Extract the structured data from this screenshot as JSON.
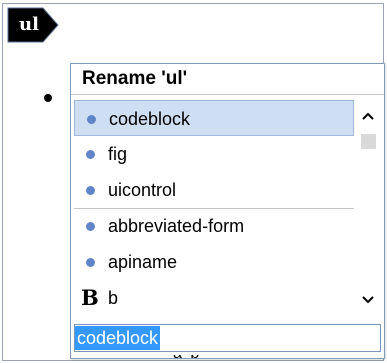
{
  "element_tag": {
    "label": "ul",
    "fill_color": "#000000",
    "text_color": "#ffffff"
  },
  "popup": {
    "title": "Rename 'ul'",
    "items": [
      {
        "label": "codeblock",
        "icon": "element-dot-icon",
        "selected": true
      },
      {
        "label": "fig",
        "icon": "element-dot-icon",
        "selected": false
      },
      {
        "label": "uicontrol",
        "icon": "element-dot-icon",
        "selected": false
      },
      {
        "label": "abbreviated-form",
        "icon": "element-dot-icon",
        "selected": false,
        "group_start": true
      },
      {
        "label": "apiname",
        "icon": "element-dot-icon",
        "selected": false
      },
      {
        "label": "b",
        "icon": "bold-b-icon",
        "glyph": "B",
        "selected": false
      }
    ],
    "search": {
      "value": "codeblock"
    }
  },
  "colors": {
    "selection_background": "#cfdff3",
    "selection_border": "#9fb8da",
    "dot_color": "#5f84c8",
    "text_highlight": "#3399ff",
    "frame_border": "#9aa3b5"
  },
  "clipped_text": "a b"
}
